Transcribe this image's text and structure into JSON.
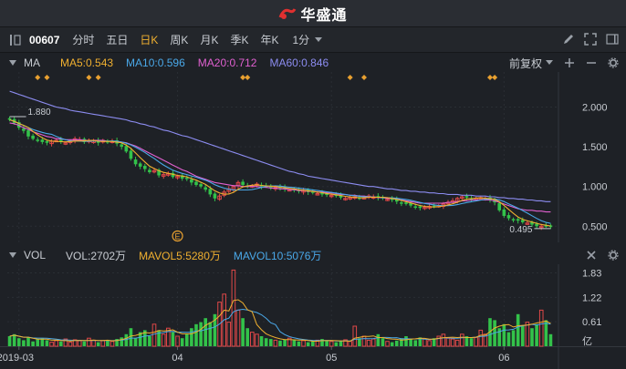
{
  "brand": {
    "name": "华盛通"
  },
  "toolbar": {
    "code": "00607",
    "periods": [
      "分时",
      "五日",
      "日K",
      "周K",
      "月K",
      "季K",
      "年K"
    ],
    "active_period": "日K",
    "minute_select": "1分"
  },
  "price_panel": {
    "indicator": "MA",
    "ma": [
      {
        "label": "MA5:0.543",
        "color": "#f0b030"
      },
      {
        "label": "MA10:0.596",
        "color": "#4aa8e8"
      },
      {
        "label": "MA20:0.712",
        "color": "#e060d0"
      },
      {
        "label": "MA60:0.846",
        "color": "#8c8cf0"
      }
    ],
    "adjust": "前复权",
    "max_label": "1.880",
    "min_label": "0.495",
    "event_marker": "E"
  },
  "volume_panel": {
    "indicator": "VOL",
    "values": [
      {
        "label": "VOL:2702万",
        "color": "#c8ccd2"
      },
      {
        "label": "MAVOL5:5280万",
        "color": "#f0b030"
      },
      {
        "label": "MAVOL10:5076万",
        "color": "#4aa8e8"
      }
    ],
    "unit": "亿"
  },
  "chart_data": [
    {
      "type": "candlestick",
      "title": "",
      "yticks": [
        "2.000",
        "1.500",
        "1.000",
        "0.500"
      ],
      "ylim": [
        0.4,
        2.35
      ],
      "x_labels": [
        "2019-03",
        "04",
        "05",
        "06"
      ],
      "x_label_positions": [
        2,
        36,
        69,
        106
      ],
      "close": [
        1.84,
        1.8,
        1.74,
        1.7,
        1.63,
        1.6,
        1.58,
        1.56,
        1.55,
        1.57,
        1.58,
        1.56,
        1.55,
        1.57,
        1.6,
        1.59,
        1.56,
        1.58,
        1.57,
        1.55,
        1.58,
        1.56,
        1.57,
        1.54,
        1.5,
        1.44,
        1.35,
        1.28,
        1.25,
        1.22,
        1.18,
        1.2,
        1.14,
        1.15,
        1.16,
        1.12,
        1.13,
        1.1,
        1.1,
        1.05,
        1.02,
        1.0,
        0.96,
        0.9,
        0.85,
        0.88,
        0.93,
        0.97,
        1.0,
        1.05,
        1.02,
        1.0,
        1.01,
        1.03,
        1.0,
        1.0,
        0.98,
        0.99,
        0.98,
        0.97,
        0.96,
        0.95,
        0.94,
        0.95,
        0.93,
        0.92,
        0.91,
        0.9,
        0.9,
        0.89,
        0.88,
        0.86,
        0.85,
        0.86,
        0.87,
        0.85,
        0.86,
        0.88,
        0.87,
        0.86,
        0.85,
        0.84,
        0.83,
        0.81,
        0.79,
        0.78,
        0.76,
        0.74,
        0.73,
        0.74,
        0.75,
        0.75,
        0.76,
        0.78,
        0.8,
        0.82,
        0.85,
        0.87,
        0.86,
        0.84,
        0.85,
        0.86,
        0.85,
        0.83,
        0.8,
        0.7,
        0.63,
        0.6,
        0.58,
        0.57,
        0.55,
        0.54,
        0.52,
        0.5,
        0.5,
        0.5,
        0.49
      ],
      "ma20": [
        1.8,
        1.79,
        1.77,
        1.74,
        1.72,
        1.69,
        1.67,
        1.65,
        1.63,
        1.62,
        1.6,
        1.6,
        1.59,
        1.59,
        1.59,
        1.59,
        1.58,
        1.58,
        1.58,
        1.58,
        1.58,
        1.57,
        1.57,
        1.57,
        1.56,
        1.55,
        1.53,
        1.51,
        1.48,
        1.45,
        1.42,
        1.39,
        1.36,
        1.33,
        1.3,
        1.27,
        1.24,
        1.21,
        1.19,
        1.16,
        1.13,
        1.11,
        1.09,
        1.07,
        1.05,
        1.04,
        1.03,
        1.02,
        1.01,
        1.01,
        1.0,
        1.0,
        1.0,
        1.0,
        0.99,
        0.99,
        0.98,
        0.98,
        0.97,
        0.97,
        0.96,
        0.96,
        0.95,
        0.95,
        0.94,
        0.94,
        0.93,
        0.93,
        0.92,
        0.92,
        0.91,
        0.9,
        0.9,
        0.89,
        0.89,
        0.88,
        0.88,
        0.87,
        0.87,
        0.86,
        0.86,
        0.85,
        0.85,
        0.84,
        0.83,
        0.82,
        0.81,
        0.8,
        0.79,
        0.79,
        0.79,
        0.79,
        0.79,
        0.79,
        0.8,
        0.8,
        0.81,
        0.82,
        0.82,
        0.83,
        0.83,
        0.83,
        0.83,
        0.83,
        0.82,
        0.8,
        0.78,
        0.76,
        0.74,
        0.72,
        0.71,
        0.7,
        0.7,
        0.69,
        0.69,
        0.68,
        0.68
      ],
      "ma60": [
        2.2,
        2.18,
        2.16,
        2.14,
        2.12,
        2.1,
        2.08,
        2.06,
        2.04,
        2.02,
        2.0,
        1.99,
        1.98,
        1.96,
        1.95,
        1.94,
        1.93,
        1.92,
        1.91,
        1.9,
        1.89,
        1.88,
        1.87,
        1.86,
        1.85,
        1.84,
        1.82,
        1.81,
        1.79,
        1.78,
        1.76,
        1.75,
        1.73,
        1.71,
        1.7,
        1.68,
        1.66,
        1.64,
        1.63,
        1.61,
        1.59,
        1.57,
        1.55,
        1.53,
        1.51,
        1.49,
        1.47,
        1.45,
        1.43,
        1.41,
        1.39,
        1.37,
        1.35,
        1.33,
        1.31,
        1.29,
        1.27,
        1.25,
        1.23,
        1.21,
        1.19,
        1.18,
        1.16,
        1.15,
        1.13,
        1.12,
        1.11,
        1.1,
        1.09,
        1.08,
        1.07,
        1.06,
        1.05,
        1.04,
        1.03,
        1.02,
        1.01,
        1.0,
        1.0,
        0.99,
        0.98,
        0.97,
        0.97,
        0.96,
        0.95,
        0.95,
        0.94,
        0.94,
        0.93,
        0.93,
        0.92,
        0.92,
        0.91,
        0.91,
        0.9,
        0.9,
        0.9,
        0.89,
        0.89,
        0.89,
        0.88,
        0.88,
        0.88,
        0.87,
        0.87,
        0.86,
        0.86,
        0.85,
        0.85,
        0.84,
        0.84,
        0.83,
        0.83,
        0.82,
        0.82,
        0.81,
        0.81
      ]
    },
    {
      "type": "bar",
      "title": "",
      "yticks": [
        "1.83",
        "1.22",
        "0.61"
      ],
      "ylim": [
        0,
        2.0
      ],
      "volume": [
        0.25,
        0.3,
        0.2,
        0.15,
        0.22,
        0.12,
        0.18,
        0.2,
        0.15,
        0.1,
        0.14,
        0.12,
        0.18,
        0.1,
        0.16,
        0.14,
        0.12,
        0.2,
        0.15,
        0.1,
        0.14,
        0.16,
        0.12,
        0.18,
        0.22,
        0.3,
        0.45,
        0.2,
        0.35,
        0.4,
        0.25,
        0.55,
        0.4,
        0.3,
        0.45,
        0.35,
        0.25,
        0.2,
        0.3,
        0.45,
        0.55,
        0.6,
        0.7,
        0.6,
        0.8,
        1.1,
        1.3,
        0.6,
        1.9,
        0.9,
        0.7,
        0.45,
        0.35,
        0.3,
        0.25,
        0.2,
        0.18,
        0.15,
        0.14,
        0.16,
        0.2,
        0.15,
        0.12,
        0.14,
        0.1,
        0.12,
        0.15,
        0.18,
        0.14,
        0.12,
        0.1,
        0.13,
        0.16,
        0.12,
        0.5,
        0.2,
        0.25,
        0.15,
        0.18,
        0.3,
        0.2,
        0.12,
        0.1,
        0.14,
        0.2,
        0.25,
        0.18,
        0.15,
        0.22,
        0.18,
        0.14,
        0.2,
        0.25,
        0.3,
        0.2,
        0.18,
        0.15,
        0.3,
        0.25,
        0.2,
        0.22,
        0.4,
        0.3,
        0.7,
        0.65,
        0.45,
        0.55,
        0.35,
        0.4,
        0.8,
        0.5,
        0.6,
        0.45,
        0.55,
        0.9,
        0.65,
        0.3
      ]
    }
  ]
}
